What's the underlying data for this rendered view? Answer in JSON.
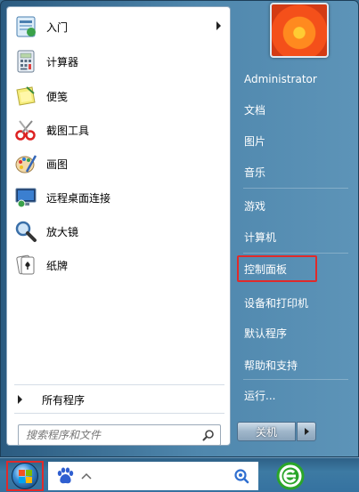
{
  "programs": [
    {
      "label": "入门",
      "icon": "getting-started-icon",
      "submenu": true
    },
    {
      "label": "计算器",
      "icon": "calculator-icon"
    },
    {
      "label": "便笺",
      "icon": "sticky-notes-icon"
    },
    {
      "label": "截图工具",
      "icon": "snipping-tool-icon"
    },
    {
      "label": "画图",
      "icon": "paint-icon"
    },
    {
      "label": "远程桌面连接",
      "icon": "remote-desktop-icon"
    },
    {
      "label": "放大镜",
      "icon": "magnifier-icon"
    },
    {
      "label": "纸牌",
      "icon": "solitaire-icon"
    }
  ],
  "all_programs_label": "所有程序",
  "search": {
    "placeholder": "搜索程序和文件"
  },
  "right_menu": {
    "user": "Administrator",
    "items": [
      {
        "label": "文档"
      },
      {
        "label": "图片"
      },
      {
        "label": "音乐"
      },
      {
        "label": "游戏"
      },
      {
        "label": "计算机"
      },
      {
        "label": "控制面板",
        "highlighted": true
      },
      {
        "label": "设备和打印机"
      },
      {
        "label": "默认程序"
      },
      {
        "label": "帮助和支持"
      },
      {
        "label": "运行..."
      }
    ]
  },
  "shutdown": {
    "label": "关机"
  },
  "colors": {
    "highlight_border": "#e02a2a",
    "menu_blue": "#4f87ad"
  }
}
